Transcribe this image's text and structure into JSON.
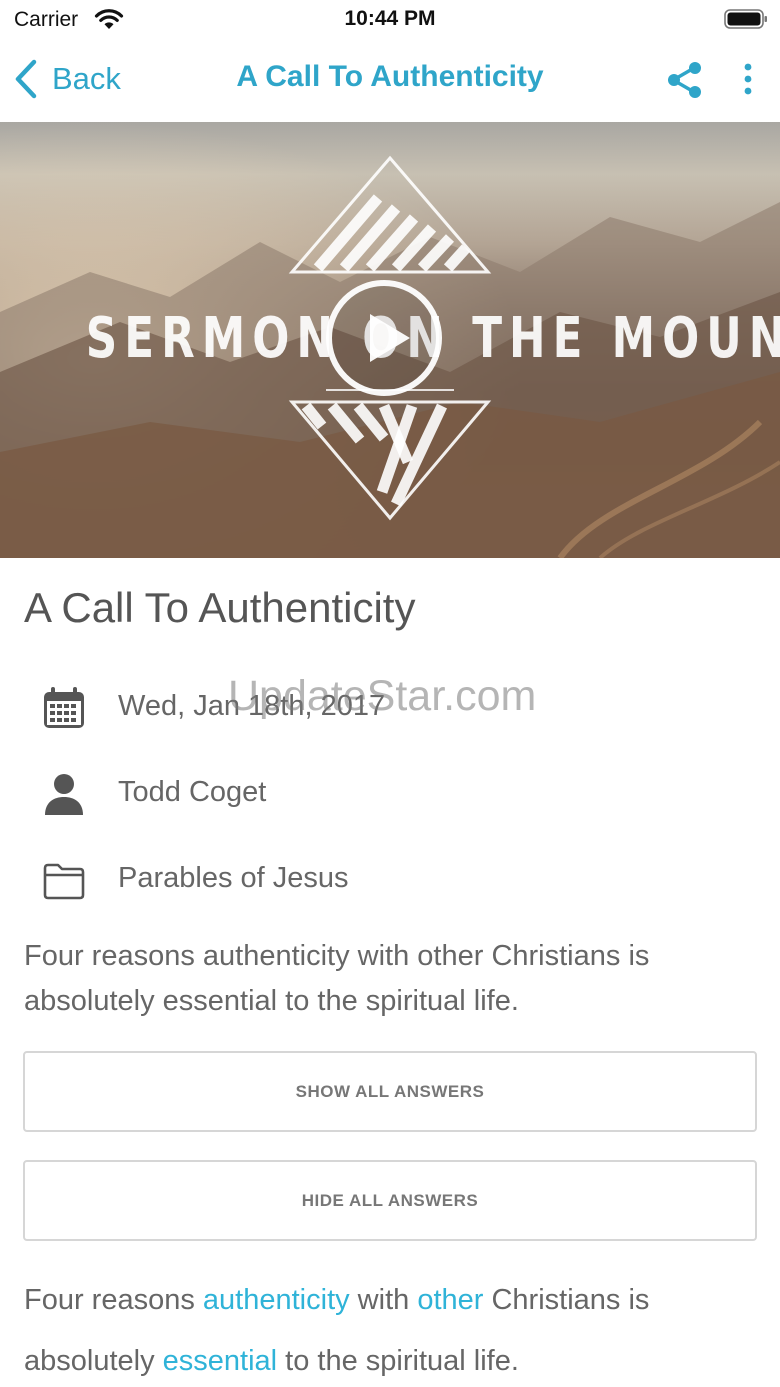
{
  "status_bar": {
    "carrier": "Carrier",
    "time": "10:44 PM"
  },
  "nav": {
    "back_label": "Back",
    "title": "A Call To Authenticity",
    "icons": [
      "chevron-left-icon",
      "share-icon",
      "more-vertical-icon"
    ]
  },
  "hero": {
    "caption": "SERMON ON THE MOUNT",
    "play_icon": "play-circle-icon"
  },
  "sermon": {
    "title": "A Call To Authenticity",
    "date": "Wed, Jan 18th, 2017",
    "speaker": "Todd Coget",
    "series": "Parables of Jesus",
    "summary": "Four reasons authenticity with other Christians is absolutely essential to the spiritual life."
  },
  "watermark": "UpdateStar.com",
  "buttons": {
    "show_all": "SHOW ALL ANSWERS",
    "hide_all": "HIDE ALL ANSWERS"
  },
  "fill_in": {
    "parts": [
      "Four reasons ",
      "authenticity",
      " with ",
      "other",
      " Christians is absolutely ",
      "essential",
      " to the spiritual life."
    ]
  },
  "colors": {
    "accent": "#2fa5c9",
    "blank_text": "#2fb3d8",
    "body_text": "#666666",
    "button_border": "#d6d6d6"
  }
}
